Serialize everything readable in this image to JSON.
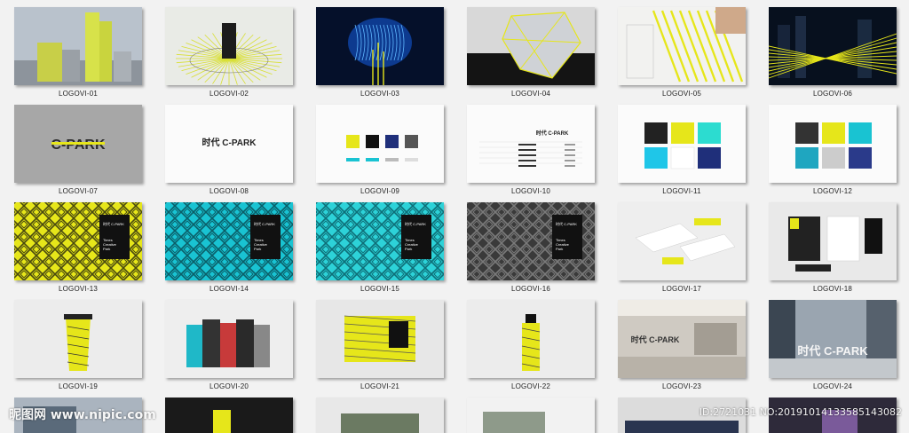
{
  "tiles": [
    {
      "caption": "LOGOVI-01",
      "kind": "buildings"
    },
    {
      "caption": "LOGOVI-02",
      "kind": "speaker"
    },
    {
      "caption": "LOGOVI-03",
      "kind": "brain"
    },
    {
      "caption": "LOGOVI-04",
      "kind": "glass"
    },
    {
      "caption": "LOGOVI-05",
      "kind": "drawing"
    },
    {
      "caption": "LOGOVI-06",
      "kind": "night"
    },
    {
      "caption": "LOGOVI-07",
      "kind": "logo-gray"
    },
    {
      "caption": "LOGOVI-08",
      "kind": "logo-white"
    },
    {
      "caption": "LOGOVI-09",
      "kind": "swatches"
    },
    {
      "caption": "LOGOVI-10",
      "kind": "table"
    },
    {
      "caption": "LOGOVI-11",
      "kind": "color-blocks"
    },
    {
      "caption": "LOGOVI-12",
      "kind": "pattern-blocks"
    },
    {
      "caption": "LOGOVI-13",
      "kind": "pattern-yellow"
    },
    {
      "caption": "LOGOVI-14",
      "kind": "pattern-cyan"
    },
    {
      "caption": "LOGOVI-15",
      "kind": "pattern-cyan2"
    },
    {
      "caption": "LOGOVI-16",
      "kind": "pattern-dark"
    },
    {
      "caption": "LOGOVI-17",
      "kind": "stationery"
    },
    {
      "caption": "LOGOVI-18",
      "kind": "stationery-dark"
    },
    {
      "caption": "LOGOVI-19",
      "kind": "cup"
    },
    {
      "caption": "LOGOVI-20",
      "kind": "bags"
    },
    {
      "caption": "LOGOVI-21",
      "kind": "box"
    },
    {
      "caption": "LOGOVI-22",
      "kind": "bottle"
    },
    {
      "caption": "LOGOVI-23",
      "kind": "lobby"
    },
    {
      "caption": "LOGOVI-24",
      "kind": "signage"
    }
  ],
  "bottom_row": [
    "mall",
    "dark-yellow",
    "plaza",
    "street",
    "night-city",
    "fountain"
  ],
  "logo_text": "C-PARK",
  "logo_text_cn": "时代 C-PARK",
  "pattern_text": [
    "Times",
    "Creative",
    "Park"
  ],
  "watermark_left": "昵图网 www.nipic.com",
  "watermark_right": "ID:2721031 NO:20191014133585143082",
  "colors": {
    "yellow": "#e6e61a",
    "cyan": "#19c3d2",
    "navy": "#1f2f7a",
    "dark": "#222222"
  }
}
